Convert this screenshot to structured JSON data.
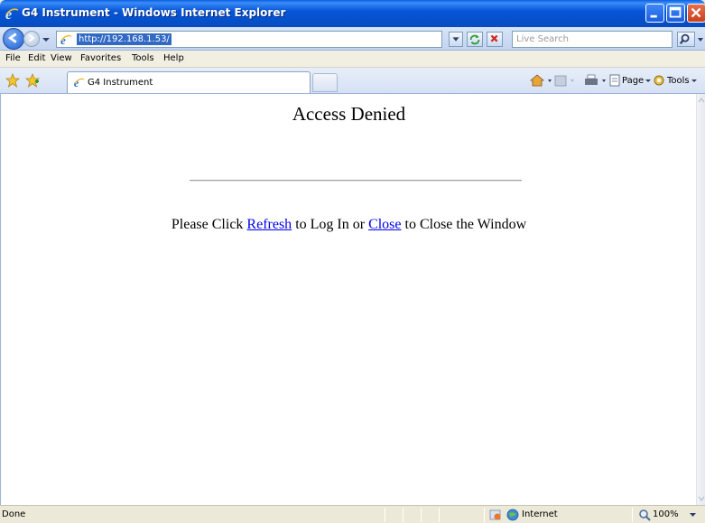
{
  "window": {
    "title": "G4 Instrument - Windows Internet Explorer"
  },
  "address_bar": {
    "url": "http://192.168.1.53/",
    "search_placeholder": "Live Search"
  },
  "menu": {
    "items": [
      "File",
      "Edit",
      "View",
      "Favorites",
      "Tools",
      "Help"
    ]
  },
  "tabs": {
    "active_label": "G4 Instrument"
  },
  "command_bar": {
    "page_label": "Page",
    "tools_label": "Tools"
  },
  "content": {
    "heading": "Access Denied",
    "message_prefix": "Please Click ",
    "refresh_link": "Refresh",
    "message_middle": " to Log In or ",
    "close_link": "Close",
    "message_suffix": " to Close the Window"
  },
  "status": {
    "text": "Done",
    "zone": "Internet",
    "zoom": "100%"
  },
  "icons": {
    "title": "ie-icon",
    "back": "back-arrow-icon",
    "forward": "forward-arrow-icon",
    "refresh": "refresh-icon",
    "stop": "stop-icon",
    "search": "search-icon",
    "favorites": "favorites-star-icon",
    "add_favorites": "add-favorites-icon",
    "home": "home-icon",
    "feeds": "feeds-icon",
    "print": "print-icon",
    "page": "page-icon",
    "tools": "gear-icon",
    "globe": "globe-icon",
    "zoom": "zoom-icon"
  }
}
